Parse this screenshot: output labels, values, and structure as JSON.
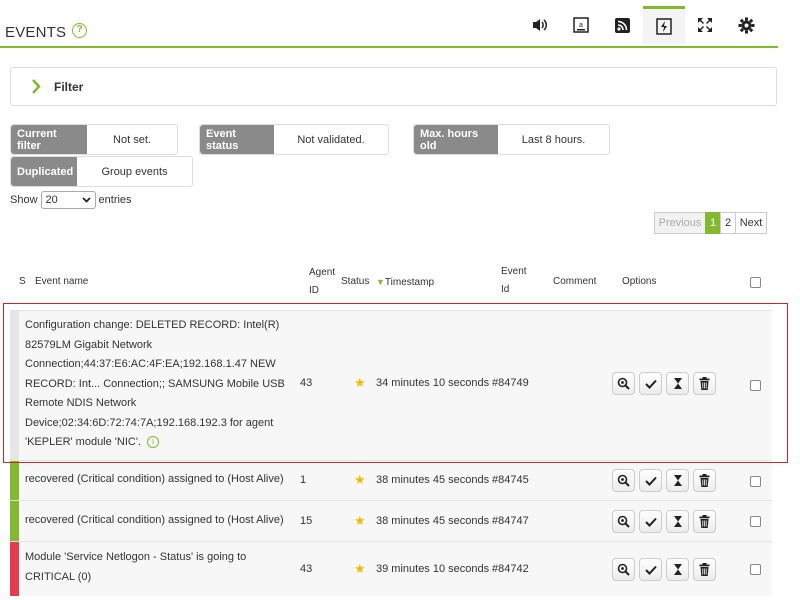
{
  "header": {
    "title": "EVENTS",
    "help_glyph": "?",
    "toolbar_icons": [
      "sound-icon",
      "agent-id-icon",
      "rss-icon",
      "events-icon",
      "fullscreen-icon",
      "gear-icon"
    ]
  },
  "filter": {
    "label": "Filter"
  },
  "chips": [
    {
      "key": "Current filter",
      "value": "Not set."
    },
    {
      "key": "Event status",
      "value": "Not validated."
    },
    {
      "key": "Max. hours old",
      "value": "Last 8 hours."
    },
    {
      "key": "Duplicated",
      "value": "Group events"
    }
  ],
  "entries": {
    "show_label": "Show",
    "value": "20",
    "suffix": "entries"
  },
  "pagination": {
    "previous": "Previous",
    "pages": [
      "1",
      "2"
    ],
    "current": "1",
    "next": "Next"
  },
  "table": {
    "headers": {
      "s": "S",
      "event_name": "Event name",
      "agent_id_1": "Agent",
      "agent_id_2": "ID",
      "status": "Status",
      "timestamp": "Timestamp",
      "event_id_1": "Event",
      "event_id_2": "Id",
      "comment": "Comment",
      "options": "Options"
    },
    "rows": [
      {
        "severity_color": "#e6e6e6",
        "event_name": "Configuration change: DELETED RECORD: Intel(R) 82579LM Gigabit Network Connection;44:37:E6:AC:4F:EA;192.168.1.47 NEW RECORD: Int... Connection;; SAMSUNG Mobile USB Remote NDIS Network Device;02:34:6D:72:74:7A;192.168.192.3 for agent 'KEPLER' module 'NIC'.",
        "agent_id": "43",
        "timestamp": "34 minutes 10 seconds",
        "event_id": "#84749",
        "selected": true
      },
      {
        "severity_color": "#82b92e",
        "event_name": "recovered (Critical condition) assigned to (Host Alive)",
        "agent_id": "1",
        "timestamp": "38 minutes 45 seconds",
        "event_id": "#84745",
        "selected": false
      },
      {
        "severity_color": "#82b92e",
        "event_name": "recovered (Critical condition) assigned to (Host Alive)",
        "agent_id": "15",
        "timestamp": "38 minutes 45 seconds",
        "event_id": "#84747",
        "selected": false
      },
      {
        "severity_color": "#e63c52",
        "event_name": "Module 'Service Netlogon - Status' is going to CRITICAL (0)",
        "agent_id": "43",
        "timestamp": "39 minutes 10 seconds",
        "event_id": "#84742",
        "selected": false
      }
    ]
  },
  "colors": {
    "accent": "#82b92e",
    "critical": "#e63c52",
    "selection": "#c72a2a",
    "star": "#f5b900"
  }
}
